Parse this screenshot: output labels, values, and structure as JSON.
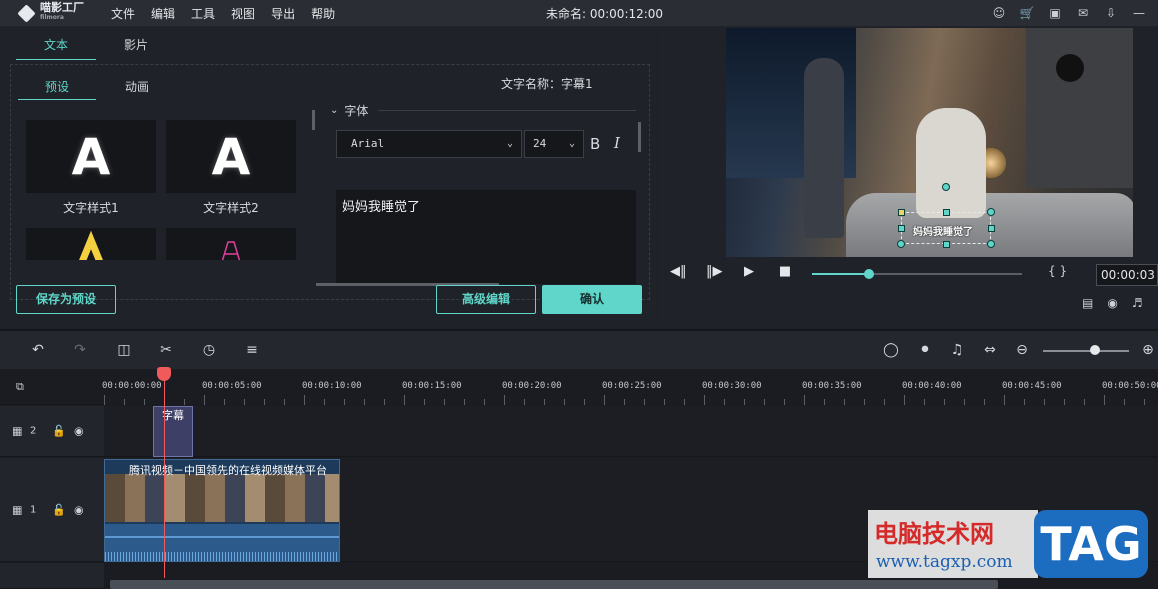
{
  "app": {
    "logo_text": "喵影工厂",
    "logo_sub": "filmora",
    "menu": [
      "文件",
      "编辑",
      "工具",
      "视图",
      "导出",
      "帮助"
    ],
    "project_title": "未命名: 00:00:12:00",
    "window_icons": [
      "user-icon",
      "cart-icon",
      "save-icon",
      "mail-icon",
      "download-icon",
      "minimize-icon"
    ]
  },
  "left_panel": {
    "tabs": [
      {
        "label": "文本",
        "active": true
      },
      {
        "label": "影片",
        "active": false
      }
    ],
    "sub_tabs": [
      {
        "label": "预设",
        "active": true
      },
      {
        "label": "动画",
        "active": false
      }
    ],
    "text_name": "文字名称：字幕1",
    "presets": [
      {
        "letter": "A",
        "label": "文字样式1"
      },
      {
        "letter": "A",
        "label": "文字样式2"
      }
    ],
    "font_section": {
      "heading": "字体",
      "font_family": "Arial",
      "font_size": "24",
      "bold": "B",
      "italic": "I",
      "text_value": "妈妈我睡觉了"
    },
    "buttons": {
      "save_preset": "保存为预设",
      "advanced_edit": "高级编辑",
      "confirm": "确认"
    }
  },
  "preview": {
    "subtitle_overlay": "妈妈我睡觉了",
    "progress": 0.27,
    "timecode": "00:00:03",
    "braces": "{ }",
    "controls": [
      "prev-frame-icon",
      "play-slow-icon",
      "play-icon",
      "stop-icon"
    ]
  },
  "toolbar": {
    "left_tools": [
      "undo-icon",
      "redo-icon",
      "delete-icon",
      "cut-icon",
      "speed-icon",
      "adjust-icon"
    ],
    "right_tools": [
      "marker-icon",
      "mic-icon",
      "music-icon",
      "fit-icon",
      "zoom-out-icon",
      "zoom-in-icon"
    ],
    "zoom_level": 0.6
  },
  "timeline": {
    "ticks": [
      "00:00:00:00",
      "00:00:05:00",
      "00:00:10:00",
      "00:00:15:00",
      "00:00:20:00",
      "00:00:25:00",
      "00:00:30:00",
      "00:00:35:00",
      "00:00:40:00",
      "00:00:45:00",
      "00:00:50:00"
    ],
    "tracks": [
      {
        "label": "2",
        "clip": "字幕"
      },
      {
        "label": "1",
        "clip": "腾讯视频－中国领先的在线视频媒体平台"
      }
    ]
  },
  "watermark": {
    "title": "电脑技术网",
    "url": "www.tagxp.com",
    "tag": "TAG"
  },
  "colors": {
    "accent": "#5fd6c9",
    "playhead": "#f05a5a",
    "background": "#1e2128"
  }
}
